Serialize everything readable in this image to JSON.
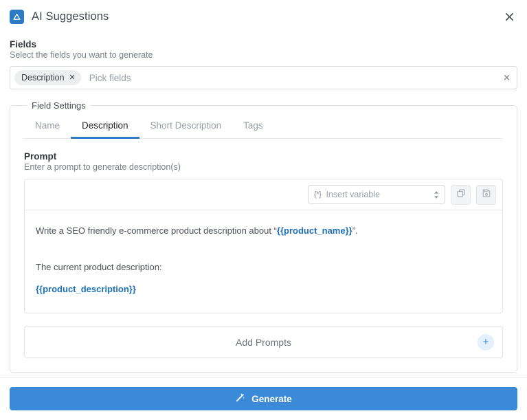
{
  "header": {
    "title": "AI Suggestions",
    "logo_icon": "ai-triangle-logo-icon",
    "close_icon": "close-icon",
    "accent_color": "#2b7cc4"
  },
  "fields": {
    "label": "Fields",
    "help": "Select the fields you want to generate",
    "chips": [
      {
        "label": "Description",
        "remove_icon": "close-icon"
      }
    ],
    "placeholder": "Pick fields",
    "clear_icon": "close-icon"
  },
  "field_settings": {
    "legend": "Field Settings",
    "tabs": [
      {
        "label": "Name",
        "active": false
      },
      {
        "label": "Description",
        "active": true
      },
      {
        "label": "Short Description",
        "active": false
      },
      {
        "label": "Tags",
        "active": false
      }
    ],
    "active_tab": "Description",
    "tab_accent_color": "#2e7dc4"
  },
  "prompt": {
    "title": "Prompt",
    "help": "Enter a prompt to generate description(s)",
    "toolbar": {
      "variable_select": {
        "glyph": "{*}",
        "placeholder": "Insert variable",
        "caret_icon": "chevron-updown-icon"
      },
      "copy_button_icon": "copy-icon",
      "save_button_icon": "save-floppy-icon"
    },
    "body": {
      "line1_before": "Write a SEO friendly e-commerce product description about “",
      "line1_variable": "{{product_name}}",
      "line1_after": "”.",
      "line2": "The current product description:",
      "line3_variable": "{{product_description}}",
      "variable_color": "#1d6fb8"
    }
  },
  "add_prompts": {
    "label": "Add Prompts",
    "add_icon": "plus-icon"
  },
  "footer": {
    "generate_label": "Generate",
    "generate_icon": "magic-wand-icon",
    "generate_color": "#3b8ad8"
  }
}
